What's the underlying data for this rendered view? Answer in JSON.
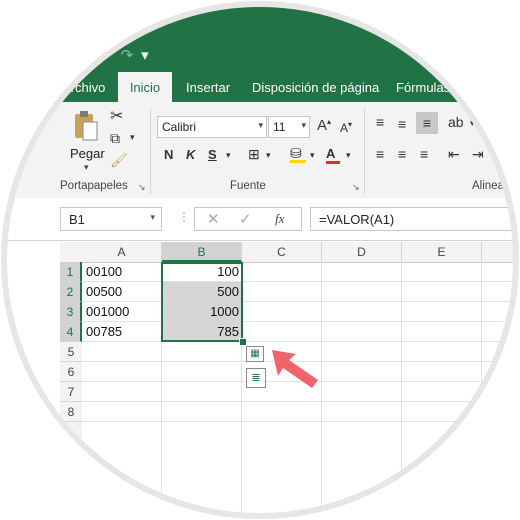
{
  "quick_access": {
    "redo": "↷",
    "dropdown": "▾"
  },
  "tabs": [
    {
      "label": "Archivo"
    },
    {
      "label": "Inicio"
    },
    {
      "label": "Insertar"
    },
    {
      "label": "Disposición de página"
    },
    {
      "label": "Fórmulas"
    }
  ],
  "ribbon": {
    "paste_label": "Pegar",
    "font_name": "Calibri",
    "font_size": "11",
    "bold": "N",
    "italic": "K",
    "underline": "S",
    "group_clipboard": "Portapapeles",
    "group_font": "Fuente",
    "group_alignment": "Alinea"
  },
  "formula_bar": {
    "name_box": "B1",
    "fx": "fx",
    "formula": "=VALOR(A1)"
  },
  "grid": {
    "columns": [
      "A",
      "B",
      "C",
      "D",
      "E"
    ],
    "rows": [
      "1",
      "2",
      "3",
      "4",
      "5",
      "6",
      "7",
      "8"
    ],
    "col_a": [
      "00100",
      "00500",
      "001000",
      "00785"
    ],
    "col_b": [
      "100",
      "500",
      "1000",
      "785"
    ]
  },
  "colors": {
    "accent": "#217346",
    "arrow": "#f0656b"
  }
}
